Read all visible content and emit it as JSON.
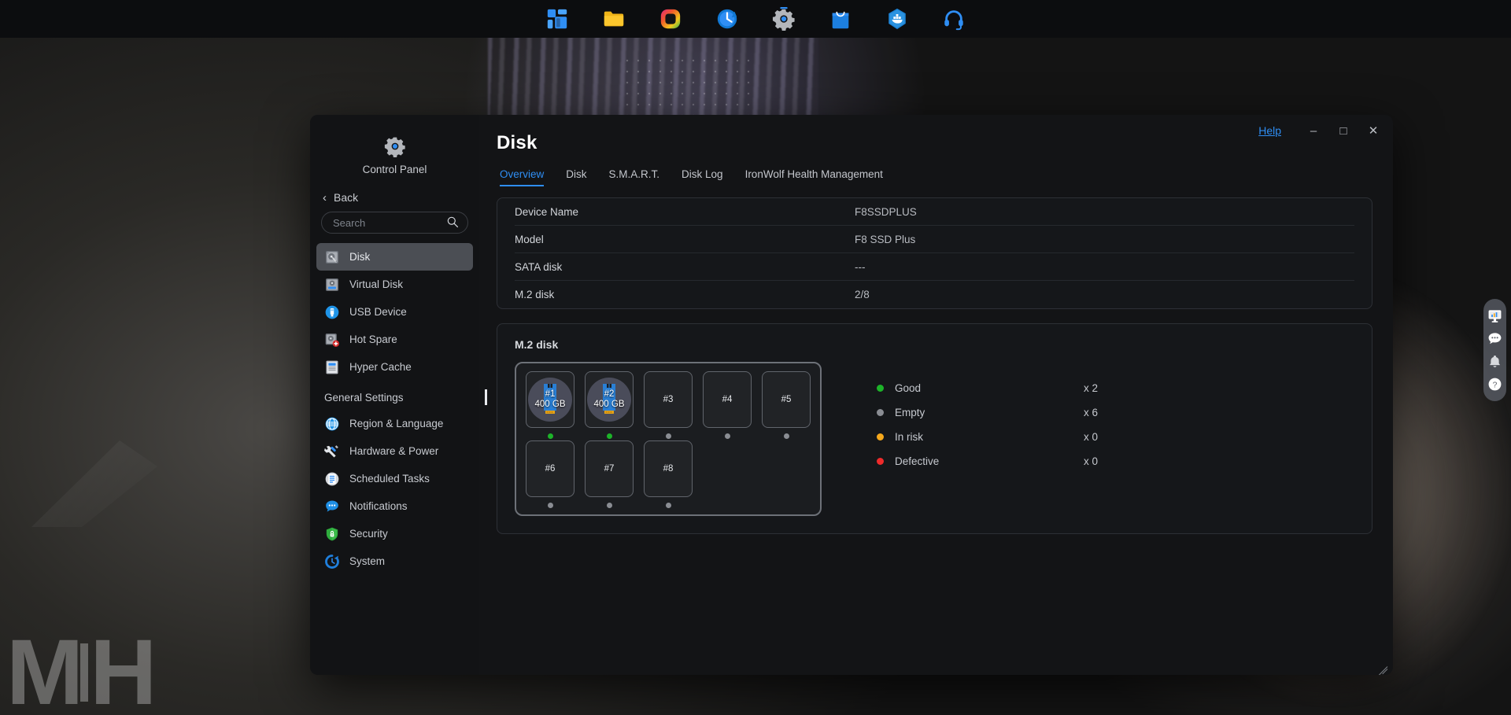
{
  "taskbar": {
    "items": [
      {
        "name": "app-launcher-icon",
        "label": "App Launcher"
      },
      {
        "name": "file-manager-icon",
        "label": "File Station"
      },
      {
        "name": "photos-icon",
        "label": "Photos"
      },
      {
        "name": "history-icon",
        "label": "Backup"
      },
      {
        "name": "control-panel-icon",
        "label": "Control Panel"
      },
      {
        "name": "app-store-icon",
        "label": "App Center"
      },
      {
        "name": "docker-icon",
        "label": "Container Station"
      },
      {
        "name": "support-headset-icon",
        "label": "Support"
      }
    ]
  },
  "window": {
    "help_label": "Help",
    "minimize_label": "–",
    "maximize_label": "□",
    "close_label": "✕"
  },
  "sidebar": {
    "app_title": "Control Panel",
    "back_label": "Back",
    "back_chevron": "‹",
    "search": {
      "value": "",
      "placeholder": "Search"
    },
    "items": [
      {
        "label": "Disk",
        "icon": "hard-disk-icon",
        "selected": true
      },
      {
        "label": "Virtual Disk",
        "icon": "virtual-disk-icon",
        "selected": false
      },
      {
        "label": "USB Device",
        "icon": "usb-device-icon",
        "selected": false
      },
      {
        "label": "Hot Spare",
        "icon": "hot-spare-icon",
        "selected": false
      },
      {
        "label": "Hyper Cache",
        "icon": "hyper-cache-icon",
        "selected": false
      }
    ],
    "section_label": "General Settings",
    "general_items": [
      {
        "label": "Region & Language",
        "icon": "globe-icon"
      },
      {
        "label": "Hardware & Power",
        "icon": "tools-icon"
      },
      {
        "label": "Scheduled Tasks",
        "icon": "scheduled-tasks-icon"
      },
      {
        "label": "Notifications",
        "icon": "notifications-icon"
      },
      {
        "label": "Security",
        "icon": "security-shield-icon"
      },
      {
        "label": "System",
        "icon": "system-icon"
      }
    ]
  },
  "main": {
    "page_title": "Disk",
    "tabs": [
      {
        "label": "Overview",
        "active": true
      },
      {
        "label": "Disk",
        "active": false
      },
      {
        "label": "S.M.A.R.T.",
        "active": false
      },
      {
        "label": "Disk Log",
        "active": false
      },
      {
        "label": "IronWolf Health Management",
        "active": false
      }
    ],
    "info_rows": [
      {
        "label": "Device Name",
        "value": "F8SSDPLUS"
      },
      {
        "label": "Model",
        "value": "F8 SSD Plus"
      },
      {
        "label": "SATA disk",
        "value": "---"
      },
      {
        "label": "M.2 disk",
        "value": "2/8"
      }
    ],
    "disk_card_title": "M.2 disk",
    "slots": [
      {
        "id": "#1",
        "capacity": "400 GB",
        "status": "good",
        "occupied": true
      },
      {
        "id": "#2",
        "capacity": "400 GB",
        "status": "good",
        "occupied": true
      },
      {
        "id": "#3",
        "capacity": "",
        "status": "empty",
        "occupied": false
      },
      {
        "id": "#4",
        "capacity": "",
        "status": "empty",
        "occupied": false
      },
      {
        "id": "#5",
        "capacity": "",
        "status": "empty",
        "occupied": false
      },
      {
        "id": "#6",
        "capacity": "",
        "status": "empty",
        "occupied": false
      },
      {
        "id": "#7",
        "capacity": "",
        "status": "empty",
        "occupied": false
      },
      {
        "id": "#8",
        "capacity": "",
        "status": "empty",
        "occupied": false
      }
    ],
    "legend": [
      {
        "label": "Good",
        "count": "x 2",
        "color": "#1db329"
      },
      {
        "label": "Empty",
        "count": "x 6",
        "color": "#8a8d93"
      },
      {
        "label": "In risk",
        "count": "x 0",
        "color": "#f5a81c"
      },
      {
        "label": "Defective",
        "count": "x 0",
        "color": "#ef2b2b"
      }
    ]
  },
  "right_dock": {
    "items": [
      {
        "name": "resource-monitor-icon",
        "label": "Resource Monitor"
      },
      {
        "name": "chat-bubble-icon",
        "label": "Chat"
      },
      {
        "name": "bell-icon",
        "label": "Notifications"
      },
      {
        "name": "help-question-icon",
        "label": "Help"
      }
    ]
  },
  "watermark": {
    "text_left": "M",
    "text_right": "H"
  },
  "colors": {
    "accent": "#2f8ef4",
    "good": "#1db329",
    "empty": "#8a8d93",
    "risk": "#f5a81c",
    "defective": "#ef2b2b",
    "window_bg": "#131416"
  }
}
